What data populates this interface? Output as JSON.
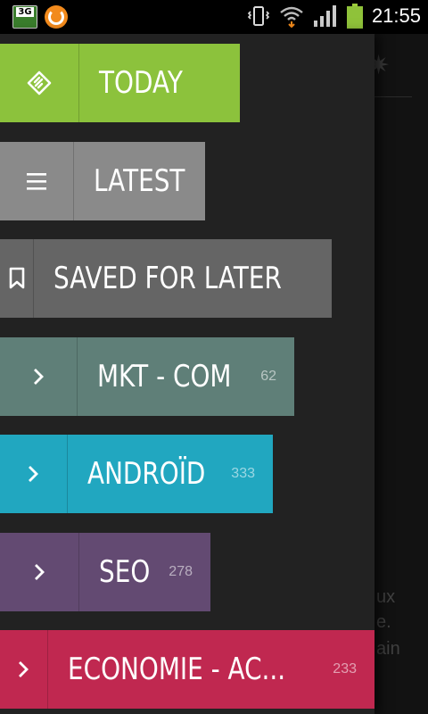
{
  "status_bar": {
    "network_badge": "3G",
    "time": "21:55",
    "icons": [
      "3g-badge-icon",
      "orange-app-icon",
      "vibrate-icon",
      "wifi-icon",
      "signal-icon",
      "battery-icon"
    ],
    "battery_color": "#8fc23a"
  },
  "drawer": {
    "items": [
      {
        "label": "TODAY",
        "count": "",
        "icon": "today-feed-icon",
        "color": "#8cc23c"
      },
      {
        "label": "LATEST",
        "count": "",
        "icon": "list-icon",
        "color": "#8a8a8a"
      },
      {
        "label": "SAVED FOR LATER",
        "count": "",
        "icon": "bookmark-icon",
        "color": "#656565"
      },
      {
        "label": "MKT - COM",
        "count": "62",
        "icon": "chevron-right-icon",
        "color": "#5f7f78"
      },
      {
        "label": "ANDROÏD",
        "count": "333",
        "icon": "chevron-right-icon",
        "color": "#21a7c0"
      },
      {
        "label": "SEO",
        "count": "278",
        "icon": "chevron-right-icon",
        "color": "#634a72"
      },
      {
        "label": "ECONOMIE - AC...",
        "count": "233",
        "icon": "chevron-right-icon",
        "color": "#c02850"
      }
    ]
  },
  "background": {
    "fragments": [
      "ux",
      "e.",
      "ain"
    ]
  }
}
